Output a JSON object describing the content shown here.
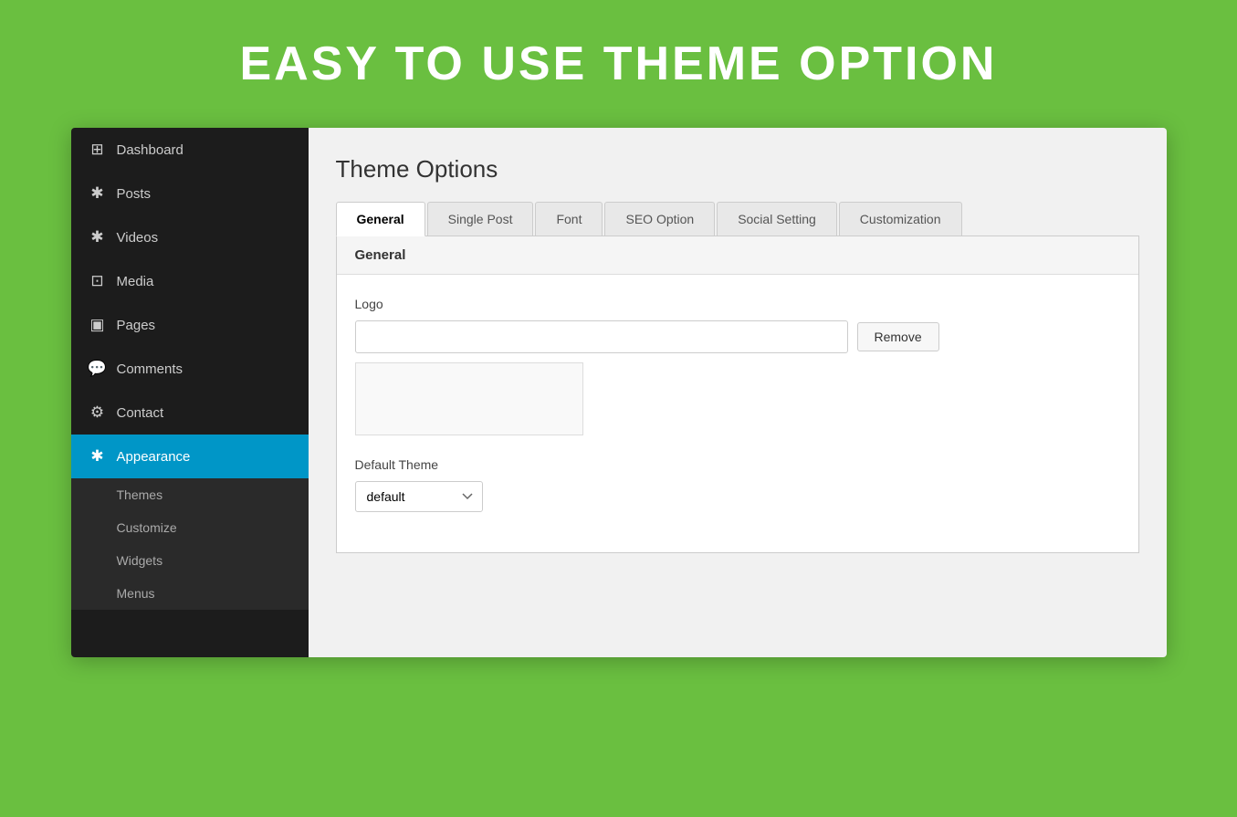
{
  "headline": "EASY TO USE THEME OPTION",
  "sidebar": {
    "items": [
      {
        "id": "dashboard",
        "label": "Dashboard",
        "icon": "⊞"
      },
      {
        "id": "posts",
        "label": "Posts",
        "icon": "✱"
      },
      {
        "id": "videos",
        "label": "Videos",
        "icon": "✱"
      },
      {
        "id": "media",
        "label": "Media",
        "icon": "⊡"
      },
      {
        "id": "pages",
        "label": "Pages",
        "icon": "▣"
      },
      {
        "id": "comments",
        "label": "Comments",
        "icon": "💬"
      },
      {
        "id": "contact",
        "label": "Contact",
        "icon": "⚙"
      },
      {
        "id": "appearance",
        "label": "Appearance",
        "icon": "✱",
        "active": true
      }
    ],
    "subItems": [
      {
        "id": "themes",
        "label": "Themes"
      },
      {
        "id": "customize",
        "label": "Customize"
      },
      {
        "id": "widgets",
        "label": "Widgets"
      },
      {
        "id": "menus",
        "label": "Menus"
      }
    ]
  },
  "main": {
    "title": "Theme Options",
    "tabs": [
      {
        "id": "general",
        "label": "General",
        "active": true
      },
      {
        "id": "single-post",
        "label": "Single Post",
        "active": false
      },
      {
        "id": "font",
        "label": "Font",
        "active": false
      },
      {
        "id": "seo-option",
        "label": "SEO Option",
        "active": false
      },
      {
        "id": "social-setting",
        "label": "Social Setting",
        "active": false
      },
      {
        "id": "customization",
        "label": "Customization",
        "active": false
      }
    ],
    "section": {
      "header": "General",
      "logo": {
        "label": "Logo",
        "placeholder": "",
        "remove_button": "Remove"
      },
      "default_theme": {
        "label": "Default Theme",
        "options": [
          "default"
        ],
        "selected": "default"
      }
    }
  }
}
